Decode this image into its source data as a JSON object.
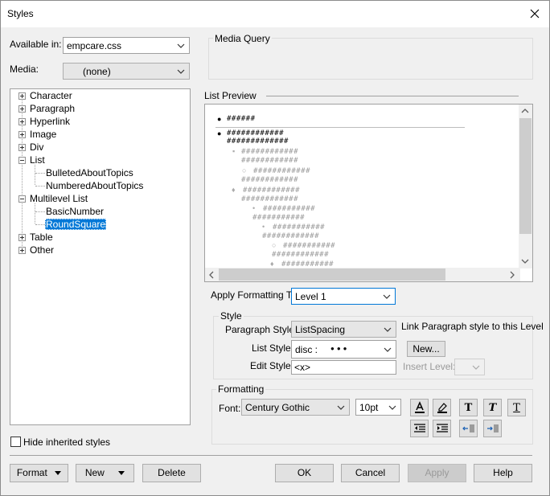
{
  "window": {
    "title": "Styles"
  },
  "available_in": {
    "label": "Available in:",
    "value": "empcare.css"
  },
  "media": {
    "label": "Media:",
    "value": "(none)"
  },
  "media_query": {
    "label": "Media Query"
  },
  "tree": {
    "character": "Character",
    "paragraph": "Paragraph",
    "hyperlink": "Hyperlink",
    "image": "Image",
    "div": "Div",
    "list": "List",
    "bulleted": "BulletedAboutTopics",
    "numbered": "NumberedAboutTopics",
    "multilevel": "Multilevel List",
    "basicnumber": "BasicNumber",
    "roundsquare": "RoundSquare",
    "table": "Table",
    "other": "Other"
  },
  "list_preview": {
    "label": "List Preview",
    "lines": [
      "######",
      "############",
      "#############",
      "############",
      "############",
      "############",
      "############",
      "############",
      "############",
      "###########",
      "###########",
      "###########",
      "############",
      "###########",
      "############",
      "###########",
      "###########",
      "############"
    ]
  },
  "apply_formatting": {
    "label": "Apply Formatting To:",
    "value": "Level 1"
  },
  "style_group": {
    "title": "Style",
    "paragraph_style_label": "Paragraph Style:",
    "paragraph_style_value": "ListSpacing",
    "link_text": "Link Paragraph style to this Level",
    "list_style_label": "List Style:",
    "list_style_value": "disc :",
    "list_style_glyphs": "●●●",
    "new_button": "New...",
    "edit_style_label": "Edit Style:",
    "edit_style_value": "<x>",
    "insert_level_label": "Insert Level:"
  },
  "formatting_group": {
    "title": "Formatting",
    "font_label": "Font:",
    "font_value": "Century Gothic",
    "size_value": "10pt"
  },
  "hide_inherited": {
    "label": "Hide inherited styles",
    "checked": false
  },
  "buttons": {
    "format": "Format",
    "new": "New",
    "delete": "Delete",
    "ok": "OK",
    "cancel": "Cancel",
    "apply": "Apply",
    "help": "Help"
  },
  "colors": {
    "selection": "#0078d7",
    "dialog_bg": "#f0f0f0"
  }
}
